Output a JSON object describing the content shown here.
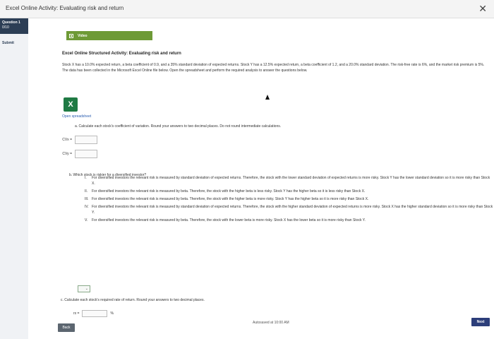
{
  "window": {
    "title": "Excel Online Activity: Evaluating risk and return",
    "close_glyph": "✕"
  },
  "sidebar": {
    "question_label": "Question 1",
    "question_score": "0/10",
    "submit_label": "Submit"
  },
  "video": {
    "label": "Video"
  },
  "main": {
    "heading": "Excel Online Structured Activity: Evaluating risk and return",
    "intro": "Stock X has a 10.0% expected return, a beta coefficient of 0.9, and a 35% standard deviation of expected returns. Stock Y has a 12.5% expected return, a beta coefficient of 1.2, and a 20.0% standard deviation. The risk-free rate is 6%, and the market risk premium is 5%. The data has been collected in the Microsoft Excel Online file below. Open the spreadsheet and perform the required analysis to answer the questions below.",
    "open_spreadsheet": "Open spreadsheet",
    "excel_glyph": "X"
  },
  "part_a": {
    "question": "a. Calculate each stock's coefficient of variation. Round your answers to two decimal places. Do not round intermediate calculations.",
    "cvx_label": "CVx =",
    "cvy_label": "CVy =",
    "cvx_value": "",
    "cvy_value": ""
  },
  "part_b": {
    "question": "b. Which stock is riskier for a diversified investor?",
    "options": [
      {
        "num": "I.",
        "text": "For diversified investors the relevant risk is measured by standard deviation of expected returns. Therefore, the stock with the lower standard deviation of expected returns is more risky. Stock Y has the lower standard deviation so it is more risky than Stock X."
      },
      {
        "num": "II.",
        "text": "For diversified investors the relevant risk is measured by beta. Therefore, the stock with the higher beta is less risky. Stock Y has the higher beta so it is less risky than Stock X."
      },
      {
        "num": "III.",
        "text": "For diversified investors the relevant risk is measured by beta. Therefore, the stock with the higher beta is more risky. Stock Y has the higher beta so it is more risky than Stock X."
      },
      {
        "num": "IV.",
        "text": "For diversified investors the relevant risk is measured by standard deviation of expected returns. Therefore, the stock with the higher standard deviation of expected returns is more risky. Stock X has the higher standard deviation so it is more risky than Stock Y."
      },
      {
        "num": "V.",
        "text": "For diversified investors the relevant risk is measured by beta. Therefore, the stock with the lower beta is more risky. Stock X has the lower beta so it is more risky than Stock Y."
      }
    ],
    "dropdown_glyph": "⌄"
  },
  "part_c": {
    "question": "c. Calculate each stock's required rate of return. Round your answers to two decimal places.",
    "rx_label": "rx =",
    "rx_value": "",
    "unit": "%"
  },
  "footer": {
    "autosave": "Autosaved at 10:00 AM",
    "back_label": "Back",
    "next_label": "Next"
  }
}
